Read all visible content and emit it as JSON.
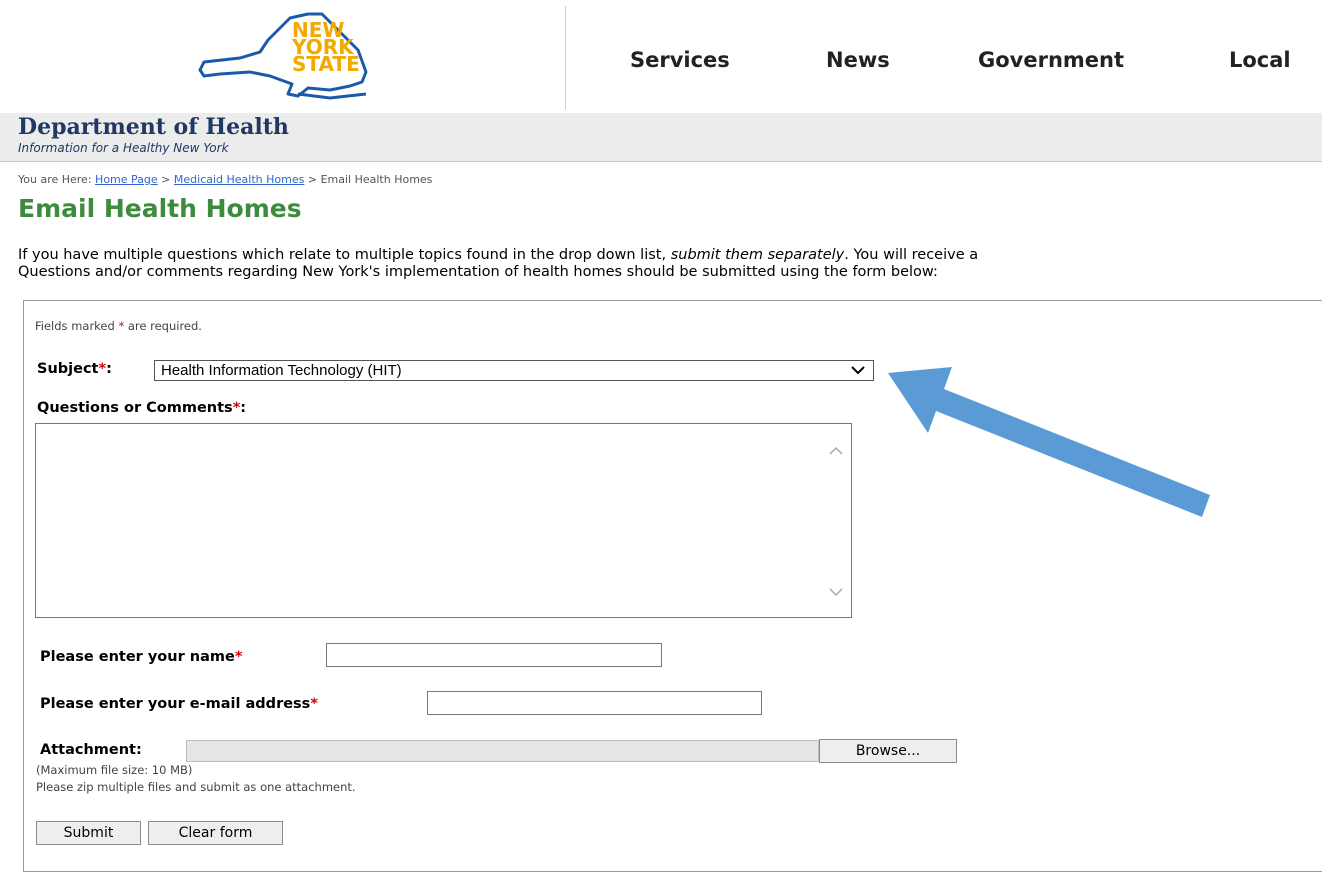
{
  "header": {
    "logo": {
      "line1": "NEW",
      "line2": "YORK",
      "line3": "STATE"
    },
    "nav": [
      "Services",
      "News",
      "Government",
      "Local"
    ]
  },
  "dept": {
    "title": "Department of Health",
    "subtitle": "Information for a Healthy New York"
  },
  "breadcrumb": {
    "prefix": "You are Here:",
    "items": [
      "Home Page",
      "Medicaid Health Homes",
      "Email Health Homes"
    ],
    "separator": ">"
  },
  "page": {
    "title": "Email Health Homes",
    "intro_line1_a": "If you have multiple questions which relate to multiple topics found in the drop down list, ",
    "intro_line1_em": "submit them separately",
    "intro_line1_b": ". You will receive a",
    "intro_line2": "Questions and/or comments regarding New York's implementation of health homes should be submitted using the form below:"
  },
  "form": {
    "required_note_a": "Fields marked ",
    "required_star": "*",
    "required_note_b": " are required.",
    "subject_label": "Subject",
    "subject_value": "Health Information Technology (HIT)",
    "comments_label": "Questions or Comments",
    "name_label": "Please enter your name",
    "email_label": "Please enter your e-mail address",
    "attachment_label": "Attachment:",
    "browse_label": "Browse...",
    "max_size_note": "(Maximum file size: 10 MB)",
    "zip_note": "Please zip multiple files and submit as one attachment.",
    "submit_label": "Submit",
    "clear_label": "Clear form",
    "colon": ":"
  },
  "colors": {
    "title_green": "#3d8b3d",
    "dept_navy": "#1f3864",
    "logo_orange": "#f2a900",
    "logo_blue": "#1a5aa8",
    "arrow_blue": "#5b9bd5",
    "required_red": "#d40000"
  }
}
